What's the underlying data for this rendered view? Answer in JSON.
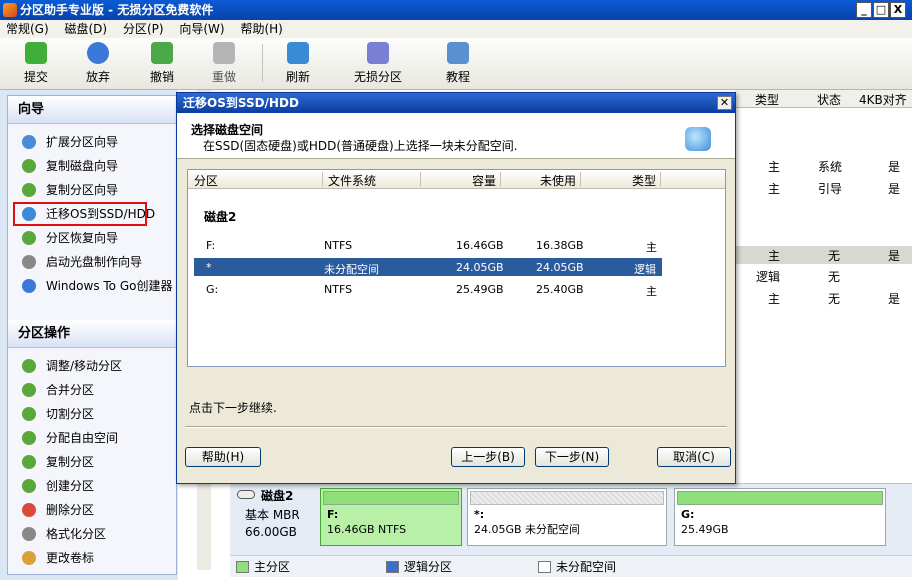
{
  "window": {
    "title": "分区助手专业版 - 无损分区免费软件",
    "controls": [
      "_",
      "□",
      "X"
    ]
  },
  "menu": [
    "常规(G)",
    "磁盘(D)",
    "分区(P)",
    "向导(W)",
    "帮助(H)"
  ],
  "toolbar": {
    "items": [
      {
        "label": "提交",
        "icon": "commit-icon"
      },
      {
        "label": "放弃",
        "icon": "discard-icon"
      },
      {
        "label": "撤销",
        "icon": "undo-icon"
      },
      {
        "label": "重做",
        "icon": "redo-icon"
      },
      {
        "label": "刷新",
        "icon": "refresh-icon"
      },
      {
        "label": "无损分区",
        "icon": "partition-icon"
      },
      {
        "label": "教程",
        "icon": "tutorial-icon"
      }
    ]
  },
  "left": {
    "wizard_title": "向导",
    "wizard_items": [
      "扩展分区向导",
      "复制磁盘向导",
      "复制分区向导",
      "迁移OS到SSD/HDD",
      "分区恢复向导",
      "启动光盘制作向导",
      "Windows To Go创建器"
    ],
    "ops_title": "分区操作",
    "ops_items": [
      "调整/移动分区",
      "合并分区",
      "切割分区",
      "分配自由空间",
      "复制分区",
      "创建分区",
      "删除分区",
      "格式化分区",
      "更改卷标"
    ]
  },
  "right_table": {
    "headers": [
      "类型",
      "状态",
      "4KB对齐"
    ],
    "rows": [
      [
        "主",
        "系统",
        "是"
      ],
      [
        "主",
        "引导",
        "是"
      ],
      [
        "主",
        "无",
        "是"
      ],
      [
        "逻辑",
        "无",
        ""
      ],
      [
        "主",
        "无",
        "是"
      ]
    ]
  },
  "disk_map": {
    "disk_name": "磁盘2",
    "disk_type": "基本 MBR",
    "disk_size": "66.00GB",
    "parts": [
      {
        "name": "F:",
        "detail": "16.46GB NTFS"
      },
      {
        "name": "*:",
        "detail": "24.05GB 未分配空间"
      },
      {
        "name": "G:",
        "detail": "25.49GB"
      }
    ]
  },
  "legend": [
    "主分区",
    "逻辑分区",
    "未分配空间"
  ],
  "dialog": {
    "title": "迁移OS到SSD/HDD",
    "heading": "选择磁盘空间",
    "subheading": "在SSD(固态硬盘)或HDD(普通硬盘)上选择一块未分配空间.",
    "columns": [
      "分区",
      "文件系统",
      "容量",
      "未使用",
      "类型"
    ],
    "disk_label": "磁盘2",
    "rows": [
      {
        "part": "F:",
        "fs": "NTFS",
        "cap": "16.46GB",
        "free": "16.38GB",
        "type": "主"
      },
      {
        "part": "*",
        "fs": "未分配空间",
        "cap": "24.05GB",
        "free": "24.05GB",
        "type": "逻辑"
      },
      {
        "part": "G:",
        "fs": "NTFS",
        "cap": "25.49GB",
        "free": "25.40GB",
        "type": "主"
      }
    ],
    "hint": "点击下一步继续.",
    "buttons": {
      "help": "帮助(H)",
      "back": "上一步(B)",
      "next": "下一步(N)",
      "cancel": "取消(C)"
    }
  },
  "colors": {
    "title_blue": "#0a5bd6",
    "selection_blue": "#2a5b9c",
    "primary_green": "#8fe07a",
    "highlight_red": "#e01010"
  }
}
